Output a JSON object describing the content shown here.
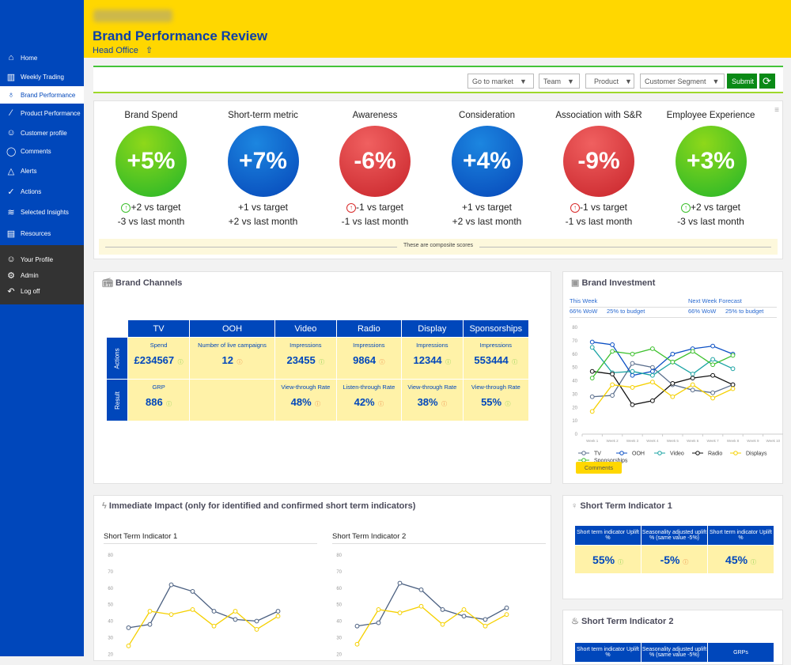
{
  "sidebar": {
    "items": [
      {
        "label": "Home",
        "icon": "home-icon",
        "g": "⌂"
      },
      {
        "label": "Weekly Trading",
        "icon": "bar-chart-icon",
        "g": "▥"
      },
      {
        "label": "Brand Performance",
        "icon": "award-icon",
        "g": "♁"
      },
      {
        "label": "Product Performance",
        "icon": "road-icon",
        "g": "⁄"
      },
      {
        "label": "Customer profile",
        "icon": "user-headset-icon",
        "g": "☺"
      },
      {
        "label": "Comments",
        "icon": "comment-icon",
        "g": "◯"
      },
      {
        "label": "Alerts",
        "icon": "bell-icon",
        "g": "△"
      },
      {
        "label": "Actions",
        "icon": "check-circle-icon",
        "g": "✓"
      },
      {
        "label": "Selected Insights",
        "icon": "layers-icon",
        "g": "≋"
      },
      {
        "label": "Resources",
        "icon": "document-icon",
        "g": "▤"
      }
    ],
    "bottom": [
      {
        "label": "Your Profile",
        "icon": "profile-icon",
        "g": "☺"
      },
      {
        "label": "Admin",
        "icon": "gear-icon",
        "g": "⚙"
      },
      {
        "label": "Log off",
        "icon": "logout-icon",
        "g": "↶"
      }
    ]
  },
  "header": {
    "title": "Brand Performance Review",
    "subtitle": "Head Office"
  },
  "filters": {
    "market": "Go to market",
    "team": "Team",
    "product": "Product",
    "segment": "Customer Segment",
    "submit": "Submit"
  },
  "colors": {
    "accent": "#0047bb",
    "header": "#ffd700",
    "green": "#2bb52b",
    "red": "#d92b2b",
    "blue": "#0a55c8"
  },
  "kpis": [
    {
      "name": "Brand Spend",
      "value": "+5%",
      "color": "green",
      "target": "+2 vs target",
      "month": "-3 vs last month",
      "arrow": "up"
    },
    {
      "name": "Short-term metric",
      "value": "+7%",
      "color": "blue",
      "target": "+1 vs target",
      "month": "+2 vs last month",
      "arrow": ""
    },
    {
      "name": "Awareness",
      "value": "-6%",
      "color": "red",
      "target": "-1 vs target",
      "month": "-1 vs last month",
      "arrow": "up-red"
    },
    {
      "name": "Consideration",
      "value": "+4%",
      "color": "blue",
      "target": "+1 vs target",
      "month": "+2 vs last month",
      "arrow": ""
    },
    {
      "name": "Association with S&R",
      "value": "-9%",
      "color": "red",
      "target": "-1 vs target",
      "month": "-1 vs last month",
      "arrow": "up-red"
    },
    {
      "name": "Employee Experience",
      "value": "+3%",
      "color": "green",
      "target": "+2 vs target",
      "month": "-3 vs last month",
      "arrow": "up"
    }
  ],
  "composite_note": "These are composite scores",
  "channels": {
    "title": "Brand Channels",
    "headers": [
      "TV",
      "OOH",
      "Video",
      "Radio",
      "Display",
      "Sponsorships"
    ],
    "row_labels": [
      "Actions",
      "Result"
    ],
    "actions": [
      {
        "label": "Spend",
        "value": "£234567",
        "trend": "up"
      },
      {
        "label": "Number of live campaigns",
        "value": "12",
        "trend": "down"
      },
      {
        "label": "Impressions",
        "value": "23455",
        "trend": "up"
      },
      {
        "label": "Impressions",
        "value": "9864",
        "trend": "down"
      },
      {
        "label": "Impressions",
        "value": "12344",
        "trend": "up"
      },
      {
        "label": "Impressions",
        "value": "553444",
        "trend": "up"
      }
    ],
    "results": [
      {
        "label": "GRP",
        "value": "886",
        "trend": "up"
      },
      {
        "label": "",
        "value": "",
        "trend": ""
      },
      {
        "label": "View-through Rate",
        "value": "48%",
        "trend": "down"
      },
      {
        "label": "Listen-through Rate",
        "value": "42%",
        "trend": "down"
      },
      {
        "label": "View-through Rate",
        "value": "38%",
        "trend": "down"
      },
      {
        "label": "View-through Rate",
        "value": "55%",
        "trend": "up"
      }
    ]
  },
  "investment": {
    "title": "Brand Investment",
    "this_week": "This Week",
    "next_week": "Next Week Forecast",
    "tw_wow": "66% WoW",
    "tw_budget": "25% to budget",
    "nw_wow": "66% WoW",
    "nw_budget": "25% to budget",
    "comments": "Comments"
  },
  "impact": {
    "title": "Immediate Impact (only for identified and confirmed short term indicators)"
  },
  "sti1": {
    "title": "Short Term Indicator 1",
    "headers": [
      "Short term indicator Uplift %",
      "Seasonality adjusted uplift % (same value -5%)",
      "Short term indicator Uplift %"
    ],
    "values": [
      {
        "v": "55%",
        "trend": "up"
      },
      {
        "v": "-5%",
        "trend": "down"
      },
      {
        "v": "45%",
        "trend": "up"
      }
    ]
  },
  "sti2": {
    "title": "Short Term Indicator 2",
    "headers": [
      "Short term indicator Uplift %",
      "Seasonality adjusted uplift % (same value -5%)",
      "GRPs"
    ]
  },
  "chart_data": [
    {
      "type": "line",
      "categories": [
        "Week 1",
        "Week 2",
        "Week 3",
        "Week 4",
        "Week 5",
        "Week 6",
        "Week 7",
        "Week 8",
        "Week 9",
        "Week 10"
      ],
      "ylim": [
        0,
        80
      ],
      "yticks": [
        0,
        10,
        20,
        30,
        40,
        50,
        60,
        70,
        80
      ],
      "legend": "bottom",
      "series": [
        {
          "name": "TV",
          "color": "#5a6e8c",
          "values": [
            28,
            29,
            53,
            50,
            37,
            33,
            31,
            37
          ]
        },
        {
          "name": "OOH",
          "color": "#0a4fc4",
          "values": [
            69,
            67,
            44,
            47,
            60,
            64,
            66,
            60
          ]
        },
        {
          "name": "Video",
          "color": "#1aa3a3",
          "values": [
            65,
            46,
            47,
            44,
            54,
            45,
            56,
            49
          ]
        },
        {
          "name": "Radio",
          "color": "#111111",
          "values": [
            47,
            45,
            22,
            25,
            38,
            42,
            44,
            37
          ]
        },
        {
          "name": "Displays",
          "color": "#f5d000",
          "values": [
            17,
            37,
            35,
            39,
            28,
            37,
            27,
            34
          ]
        },
        {
          "name": "Sponsorships",
          "color": "#3cc02c",
          "values": [
            42,
            62,
            60,
            64,
            54,
            62,
            52,
            59
          ]
        }
      ]
    },
    {
      "type": "line",
      "title": "Short Term Indicator 1",
      "ylim": [
        0,
        80
      ],
      "yticks": [
        10,
        20,
        30,
        40,
        50,
        60,
        70,
        80
      ],
      "series": [
        {
          "color": "#4a5f80",
          "values": [
            36,
            38,
            62,
            58,
            46,
            41,
            40,
            46
          ]
        },
        {
          "color": "#f5d000",
          "values": [
            25,
            46,
            44,
            47,
            37,
            46,
            35,
            43
          ]
        }
      ]
    },
    {
      "type": "line",
      "title": "Short Term Indicator 2",
      "ylim": [
        0,
        80
      ],
      "yticks": [
        10,
        20,
        30,
        40,
        50,
        60,
        70,
        80
      ],
      "series": [
        {
          "color": "#4a5f80",
          "values": [
            37,
            39,
            63,
            59,
            47,
            43,
            41,
            48
          ]
        },
        {
          "color": "#f5d000",
          "values": [
            26,
            47,
            45,
            49,
            38,
            47,
            37,
            44
          ]
        }
      ]
    }
  ]
}
